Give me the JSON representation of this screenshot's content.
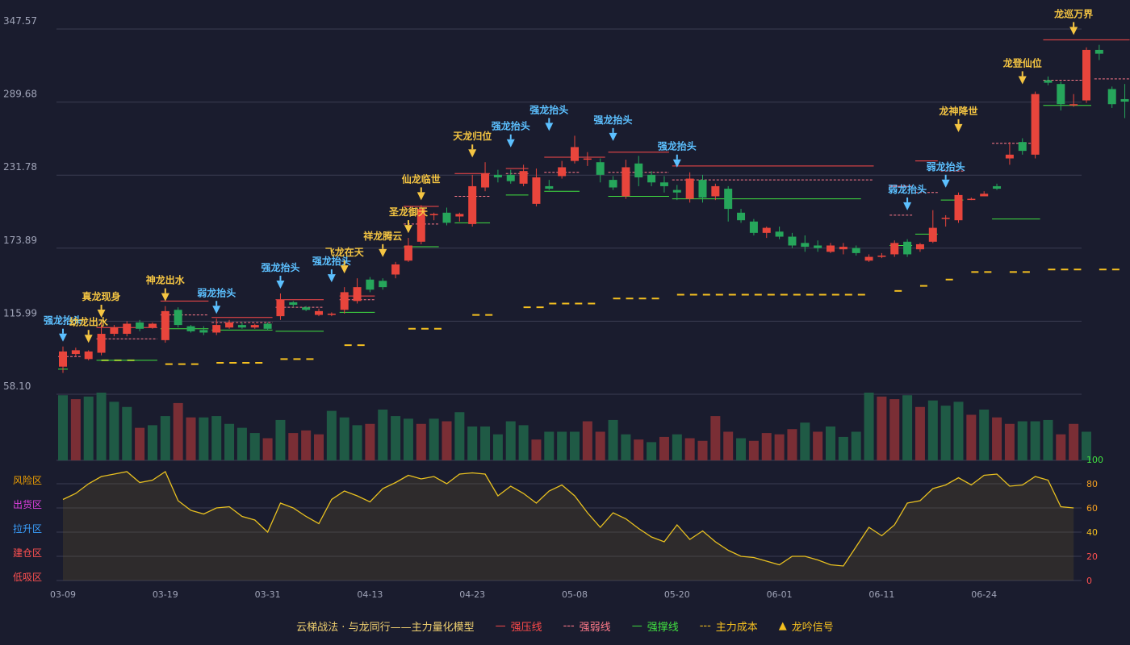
{
  "chart_data": {
    "type": "candlestick",
    "y_axis": {
      "ticks": [
        "347.57",
        "289.68",
        "231.78",
        "173.89",
        "115.99",
        "58.10"
      ],
      "ylim": [
        58.1,
        347.57
      ]
    },
    "x_axis": {
      "ticks": [
        {
          "label": "03-09",
          "idx": 0
        },
        {
          "label": "03-19",
          "idx": 8
        },
        {
          "label": "03-31",
          "idx": 16
        },
        {
          "label": "04-13",
          "idx": 24
        },
        {
          "label": "04-23",
          "idx": 32
        },
        {
          "label": "05-08",
          "idx": 40
        },
        {
          "label": "05-20",
          "idx": 48
        },
        {
          "label": "06-01",
          "idx": 56
        },
        {
          "label": "06-11",
          "idx": 64
        },
        {
          "label": "06-24",
          "idx": 72
        }
      ]
    },
    "candles": [
      [
        80,
        92,
        75,
        96
      ],
      [
        90,
        93,
        88,
        95
      ],
      [
        86,
        92,
        85,
        93
      ],
      [
        91,
        106,
        89,
        115
      ],
      [
        106,
        111,
        104,
        113
      ],
      [
        106,
        114,
        104,
        116
      ],
      [
        115,
        110,
        108,
        117
      ],
      [
        111,
        114,
        110,
        115
      ],
      [
        101,
        124,
        99,
        128
      ],
      [
        125,
        113,
        111,
        127
      ],
      [
        112,
        108,
        107,
        113
      ],
      [
        109,
        107,
        105,
        112
      ],
      [
        107,
        113,
        105,
        118
      ],
      [
        111,
        115,
        110,
        117
      ],
      [
        113,
        111,
        110,
        115
      ],
      [
        111,
        113,
        110,
        114
      ],
      [
        114,
        110,
        109,
        115
      ],
      [
        120,
        133,
        117,
        138
      ],
      [
        131,
        129,
        127,
        132
      ],
      [
        127,
        125,
        124,
        128
      ],
      [
        121,
        124,
        120,
        126
      ],
      [
        121,
        122,
        120,
        123
      ],
      [
        125,
        139,
        122,
        143
      ],
      [
        132,
        143,
        130,
        150
      ],
      [
        149,
        141,
        139,
        151
      ],
      [
        148,
        143,
        141,
        150
      ],
      [
        153,
        161,
        150,
        163
      ],
      [
        164,
        176,
        163,
        182
      ],
      [
        179,
        205,
        177,
        208
      ],
      [
        200,
        201,
        196,
        202
      ],
      [
        202,
        194,
        192,
        206
      ],
      [
        199,
        201,
        195,
        202
      ],
      [
        193,
        223,
        191,
        232
      ],
      [
        222,
        233,
        219,
        242
      ],
      [
        232,
        230,
        226,
        236
      ],
      [
        232,
        227,
        225,
        236
      ],
      [
        225,
        235,
        223,
        240
      ],
      [
        209,
        230,
        207,
        237
      ],
      [
        223,
        221,
        220,
        228
      ],
      [
        231,
        238,
        229,
        243
      ],
      [
        243,
        254,
        241,
        263
      ],
      [
        244,
        245,
        239,
        250
      ],
      [
        242,
        232,
        226,
        245
      ],
      [
        228,
        222,
        220,
        231
      ],
      [
        215,
        238,
        213,
        244
      ],
      [
        241,
        230,
        223,
        247
      ],
      [
        232,
        226,
        223,
        235
      ],
      [
        226,
        223,
        218,
        231
      ],
      [
        220,
        218,
        212,
        224
      ],
      [
        213,
        229,
        210,
        234
      ],
      [
        228,
        214,
        210,
        232
      ],
      [
        215,
        223,
        212,
        225
      ],
      [
        221,
        205,
        195,
        223
      ],
      [
        202,
        196,
        194,
        205
      ],
      [
        195,
        186,
        184,
        197
      ],
      [
        186,
        190,
        182,
        191
      ],
      [
        187,
        183,
        181,
        191
      ],
      [
        183,
        176,
        174,
        186
      ],
      [
        178,
        175,
        171,
        184
      ],
      [
        176,
        174,
        171,
        180
      ],
      [
        171,
        176,
        170,
        178
      ],
      [
        173,
        175,
        169,
        178
      ],
      [
        174,
        170,
        168,
        176
      ],
      [
        164,
        167,
        163,
        169
      ],
      [
        167,
        168,
        166,
        170
      ],
      [
        169,
        178,
        167,
        180
      ],
      [
        179,
        169,
        167,
        181
      ],
      [
        173,
        177,
        171,
        178
      ],
      [
        179,
        190,
        178,
        204
      ],
      [
        198,
        198,
        191,
        200
      ],
      [
        196,
        216,
        194,
        218
      ],
      [
        213,
        213,
        212,
        214
      ],
      [
        215,
        217,
        215,
        219
      ],
      [
        223,
        221,
        220,
        225
      ],
      [
        245,
        248,
        240,
        258
      ],
      [
        258,
        251,
        248,
        261
      ],
      [
        248,
        296,
        245,
        298
      ],
      [
        307,
        305,
        303,
        310
      ],
      [
        304,
        288,
        283,
        306
      ],
      [
        287,
        288,
        286,
        296
      ],
      [
        291,
        331,
        289,
        333
      ],
      [
        331,
        328,
        323,
        335
      ],
      [
        300,
        288,
        285,
        302
      ],
      [
        292,
        290,
        277,
        304
      ]
    ],
    "volume": [
      [
        50,
        1
      ],
      [
        47,
        0
      ],
      [
        49,
        1
      ],
      [
        52,
        1
      ],
      [
        45,
        1
      ],
      [
        41,
        1
      ],
      [
        25,
        0
      ],
      [
        27,
        1
      ],
      [
        34,
        1
      ],
      [
        44,
        0
      ],
      [
        33,
        0
      ],
      [
        33,
        1
      ],
      [
        34,
        1
      ],
      [
        28,
        1
      ],
      [
        25,
        1
      ],
      [
        21,
        1
      ],
      [
        17,
        0
      ],
      [
        31,
        1
      ],
      [
        21,
        0
      ],
      [
        23,
        0
      ],
      [
        20,
        0
      ],
      [
        38,
        1
      ],
      [
        33,
        1
      ],
      [
        27,
        1
      ],
      [
        28,
        0
      ],
      [
        39,
        1
      ],
      [
        34,
        1
      ],
      [
        32,
        1
      ],
      [
        28,
        0
      ],
      [
        32,
        1
      ],
      [
        30,
        0
      ],
      [
        37,
        1
      ],
      [
        26,
        1
      ],
      [
        26,
        1
      ],
      [
        20,
        1
      ],
      [
        30,
        1
      ],
      [
        27,
        1
      ],
      [
        16,
        0
      ],
      [
        22,
        1
      ],
      [
        22,
        1
      ],
      [
        22,
        1
      ],
      [
        30,
        0
      ],
      [
        22,
        0
      ],
      [
        31,
        1
      ],
      [
        20,
        1
      ],
      [
        16,
        0
      ],
      [
        14,
        1
      ],
      [
        18,
        0
      ],
      [
        20,
        1
      ],
      [
        17,
        0
      ],
      [
        15,
        0
      ],
      [
        34,
        0
      ],
      [
        22,
        0
      ],
      [
        17,
        1
      ],
      [
        15,
        0
      ],
      [
        21,
        0
      ],
      [
        20,
        0
      ],
      [
        24,
        0
      ],
      [
        29,
        1
      ],
      [
        22,
        0
      ],
      [
        26,
        1
      ],
      [
        18,
        1
      ],
      [
        22,
        1
      ],
      [
        52,
        1
      ],
      [
        49,
        0
      ],
      [
        47,
        0
      ],
      [
        50,
        1
      ],
      [
        41,
        0
      ],
      [
        46,
        1
      ],
      [
        42,
        1
      ],
      [
        45,
        1
      ],
      [
        35,
        0
      ],
      [
        39,
        1
      ],
      [
        33,
        0
      ],
      [
        28,
        0
      ],
      [
        30,
        1
      ],
      [
        30,
        1
      ],
      [
        31,
        1
      ],
      [
        20,
        0
      ],
      [
        28,
        0
      ],
      [
        22,
        1
      ]
    ],
    "main_cost_segments": [
      [
        3,
        6,
        85
      ],
      [
        8,
        11,
        82
      ],
      [
        12,
        16,
        83
      ],
      [
        17,
        20,
        86
      ],
      [
        22,
        24,
        97
      ],
      [
        27,
        30,
        110
      ],
      [
        32,
        34,
        121
      ],
      [
        36,
        38,
        127
      ],
      [
        38,
        42,
        130
      ],
      [
        43,
        47,
        134
      ],
      [
        48,
        63,
        137
      ],
      [
        65,
        66,
        140
      ],
      [
        67,
        68,
        144
      ],
      [
        69,
        70,
        149
      ],
      [
        71,
        73,
        155
      ],
      [
        74,
        76,
        155
      ],
      [
        77,
        80,
        157
      ],
      [
        81,
        83,
        157
      ]
    ],
    "support_lines": [
      [
        0,
        0,
        78
      ],
      [
        3,
        7,
        85
      ],
      [
        8,
        11,
        110
      ],
      [
        12,
        16,
        109
      ],
      [
        17,
        20,
        108
      ],
      [
        22,
        24,
        123
      ],
      [
        27,
        29,
        175
      ],
      [
        31,
        33,
        194
      ],
      [
        35,
        36,
        216
      ],
      [
        38,
        40,
        219
      ],
      [
        43,
        47,
        215
      ],
      [
        48,
        62,
        213
      ],
      [
        65,
        66,
        176
      ],
      [
        67,
        68,
        185
      ],
      [
        69,
        70,
        212
      ],
      [
        73,
        76,
        197
      ],
      [
        77,
        80,
        287
      ]
    ],
    "pressure_lines": [
      [
        3,
        7,
        111
      ],
      [
        8,
        11,
        132
      ],
      [
        12,
        16,
        119
      ],
      [
        17,
        20,
        133
      ],
      [
        22,
        24,
        136
      ],
      [
        27,
        29,
        207
      ],
      [
        31,
        33,
        233
      ],
      [
        35,
        36,
        237
      ],
      [
        38,
        42,
        246
      ],
      [
        43,
        47,
        250
      ],
      [
        48,
        63,
        239
      ],
      [
        65,
        66,
        223
      ],
      [
        67,
        68,
        243
      ],
      [
        77,
        83,
        339
      ]
    ],
    "weak_lines": [
      [
        0,
        1,
        88
      ],
      [
        3,
        7,
        102
      ],
      [
        8,
        11,
        121
      ],
      [
        12,
        16,
        115
      ],
      [
        17,
        20,
        127
      ],
      [
        22,
        24,
        133
      ],
      [
        27,
        29,
        193
      ],
      [
        31,
        33,
        215
      ],
      [
        35,
        36,
        233
      ],
      [
        38,
        40,
        234
      ],
      [
        43,
        47,
        234
      ],
      [
        48,
        63,
        228
      ],
      [
        65,
        66,
        200
      ],
      [
        67,
        68,
        218
      ],
      [
        69,
        70,
        235
      ],
      [
        73,
        76,
        257
      ],
      [
        77,
        80,
        307
      ],
      [
        81,
        83,
        308
      ]
    ],
    "signals": [
      {
        "idx": 0,
        "text": "强龙抬头",
        "kind": "blue",
        "price": 96
      },
      {
        "idx": 2,
        "text": "幼龙出水",
        "kind": "gold",
        "price": 95
      },
      {
        "idx": 3,
        "text": "真龙现身",
        "kind": "gold",
        "price": 115
      },
      {
        "idx": 8,
        "text": "神龙出水",
        "kind": "gold",
        "price": 128
      },
      {
        "idx": 12,
        "text": "弱龙抬头",
        "kind": "blue",
        "price": 118
      },
      {
        "idx": 17,
        "text": "强龙抬头",
        "kind": "blue",
        "price": 138
      },
      {
        "idx": 21,
        "text": "强龙抬头",
        "kind": "blue",
        "price": 143
      },
      {
        "idx": 22,
        "text": "飞龙在天",
        "kind": "gold",
        "price": 150
      },
      {
        "idx": 25,
        "text": "祥龙腾云",
        "kind": "gold",
        "price": 163
      },
      {
        "idx": 27,
        "text": "圣龙御天",
        "kind": "gold",
        "price": 182
      },
      {
        "idx": 28,
        "text": "仙龙临世",
        "kind": "gold",
        "price": 208
      },
      {
        "idx": 32,
        "text": "天龙归位",
        "kind": "gold",
        "price": 242
      },
      {
        "idx": 35,
        "text": "强龙抬头",
        "kind": "blue",
        "price": 250
      },
      {
        "idx": 38,
        "text": "强龙抬头",
        "kind": "blue",
        "price": 263
      },
      {
        "idx": 43,
        "text": "强龙抬头",
        "kind": "blue",
        "price": 255
      },
      {
        "idx": 48,
        "text": "强龙抬头",
        "kind": "blue",
        "price": 234
      },
      {
        "idx": 66,
        "text": "弱龙抬头",
        "kind": "blue",
        "price": 200
      },
      {
        "idx": 69,
        "text": "弱龙抬头",
        "kind": "blue",
        "price": 218
      },
      {
        "idx": 70,
        "text": "龙神降世",
        "kind": "gold",
        "price": 262
      },
      {
        "idx": 75,
        "text": "龙登仙位",
        "kind": "gold",
        "price": 300
      },
      {
        "idx": 79,
        "text": "龙巡万界",
        "kind": "gold",
        "price": 339
      }
    ],
    "oscillator": {
      "values": [
        67,
        72,
        80,
        86,
        88,
        90,
        81,
        83,
        90,
        66,
        58,
        55,
        60,
        61,
        53,
        50,
        40,
        64,
        60,
        53,
        47,
        67,
        74,
        70,
        65,
        76,
        81,
        87,
        84,
        86,
        80,
        88,
        89,
        88,
        70,
        78,
        72,
        64,
        74,
        79,
        70,
        56,
        44,
        56,
        51,
        43,
        36,
        32,
        46,
        34,
        41,
        32,
        25,
        20,
        19,
        16,
        13,
        20,
        20,
        17,
        13,
        12,
        28,
        44,
        37,
        46,
        64,
        66,
        76,
        79,
        85,
        79,
        87,
        88,
        78,
        79,
        86,
        83,
        61,
        60
      ],
      "ylim": [
        0,
        100
      ],
      "right_ticks": [
        "100",
        "80",
        "60",
        "40",
        "20",
        "0"
      ],
      "zones": [
        {
          "label": "风险区",
          "color": "#f0a000"
        },
        {
          "label": "出货区",
          "color": "#e040e0"
        },
        {
          "label": "拉升区",
          "color": "#3aa0ff"
        },
        {
          "label": "建仓区",
          "color": "#ff5050"
        },
        {
          "label": "低吸区",
          "color": "#ff5050"
        }
      ]
    },
    "legend": {
      "title": "云梯战法 · 与龙同行——主力量化模型",
      "items": [
        {
          "label": "强压线",
          "symbol": "—",
          "color": "#ff4a4a"
        },
        {
          "label": "强弱线",
          "symbol": "---",
          "color": "#ff7a8a"
        },
        {
          "label": "强撑线",
          "symbol": "—",
          "color": "#40e040"
        },
        {
          "label": "主力成本",
          "symbol": "---",
          "color": "#f5c020"
        },
        {
          "label": "龙吟信号",
          "symbol": "▲",
          "color": "#f5c020"
        }
      ]
    },
    "colors": {
      "up": "#e8453c",
      "down": "#26a65b",
      "vol_up": "#7a2e35",
      "vol_down": "#1f5a45",
      "gold": "#f5c542",
      "blue": "#5cc0ff",
      "grid": "#3a3d52",
      "axis": "#a0a4b8"
    }
  }
}
